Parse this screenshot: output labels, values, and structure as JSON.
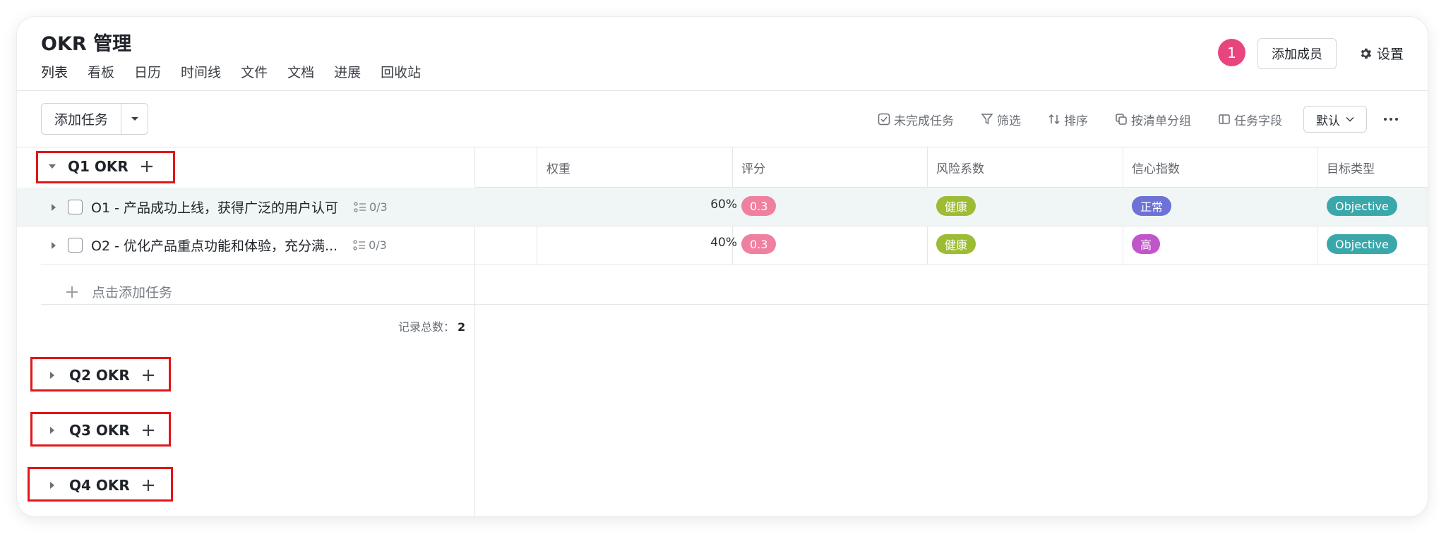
{
  "header": {
    "title": "OKR 管理",
    "tabs": [
      "列表",
      "看板",
      "日历",
      "时间线",
      "文件",
      "文档",
      "进展",
      "回收站"
    ],
    "notification_count": "1",
    "add_member_label": "添加成员",
    "settings_label": "设置"
  },
  "toolbar": {
    "add_task_label": "添加任务",
    "incomplete_label": "未完成任务",
    "filter_label": "筛选",
    "sort_label": "排序",
    "group_label": "按清单分组",
    "fields_label": "任务字段",
    "default_label": "默认"
  },
  "columns": [
    "权重",
    "评分",
    "风险系数",
    "信心指数",
    "目标类型"
  ],
  "groups": [
    {
      "label": "Q1 OKR",
      "expanded": true,
      "rows": [
        {
          "title": "O1 - 产品成功上线，获得广泛的用户认可",
          "subtasks": "0/3",
          "weight": "60%",
          "score": "0.3",
          "risk": "健康",
          "confidence": "正常",
          "type": "Objective"
        },
        {
          "title": "O2 - 优化产品重点功能和体验，充分满...",
          "subtasks": "0/3",
          "weight": "40%",
          "score": "0.3",
          "risk": "健康",
          "confidence": "高",
          "type": "Objective"
        }
      ],
      "add_task_label": "点击添加任务",
      "count_label": "记录总数：",
      "count": "2"
    },
    {
      "label": "Q2 OKR",
      "expanded": false
    },
    {
      "label": "Q3 OKR",
      "expanded": false
    },
    {
      "label": "Q4 OKR",
      "expanded": false
    }
  ],
  "colors": {
    "score": "#f0809f",
    "risk_healthy": "#9cbc34",
    "confidence_normal": "#6c72d6",
    "confidence_high": "#c056c9",
    "objective": "#3aa8ab",
    "notification": "#e8457e",
    "highlight_box": "#e0161a"
  },
  "icons": [
    "gear-icon",
    "caret-down-icon",
    "check-square-icon",
    "filter-icon",
    "sort-icon",
    "group-icon",
    "columns-icon",
    "chevron-down-icon",
    "more-icon",
    "caret-right-icon",
    "plus-icon",
    "subtask-icon"
  ]
}
